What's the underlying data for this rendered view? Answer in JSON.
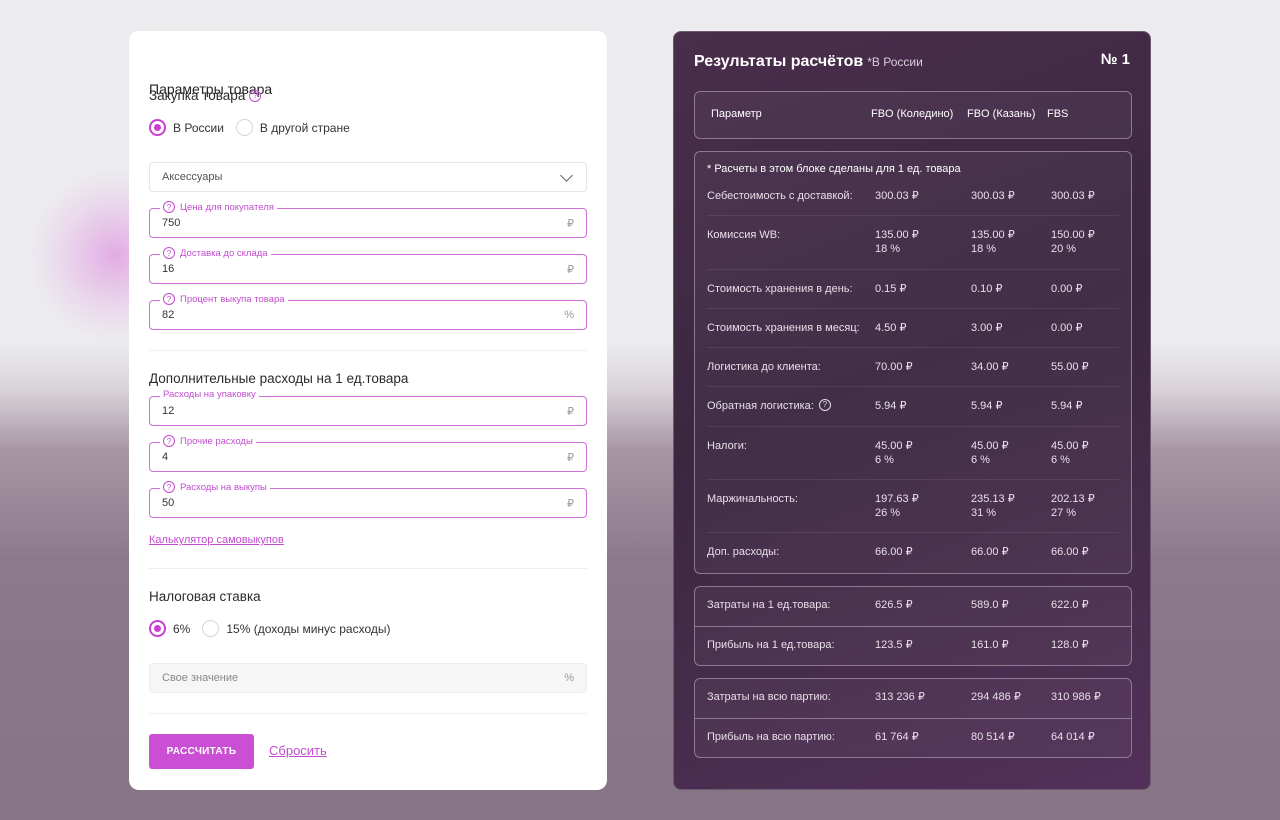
{
  "params": {
    "title": "Параметры товара",
    "purchase_label": "Закупка товара",
    "purchase_options": [
      "В России",
      "В другой стране"
    ],
    "category": "Аксессуары",
    "price_label": "Цена для покупателя",
    "price_value": "750",
    "price_unit": "₽",
    "delivery_label": "Доставка до склада",
    "delivery_value": "16",
    "delivery_unit": "₽",
    "buyout_label": "Процент выкупа товара",
    "buyout_value": "82",
    "buyout_unit": "%",
    "extra_title": "Дополнительные расходы на 1 ед.товара",
    "pack_label": "Расходы на упаковку",
    "pack_value": "12",
    "pack_unit": "₽",
    "other_label": "Прочие расходы",
    "other_value": "4",
    "other_unit": "₽",
    "redemption_label": "Расходы на выкупы",
    "redemption_value": "50",
    "redemption_unit": "₽",
    "calc_link": "Калькулятор самовыкупов",
    "tax_title": "Налоговая ставка",
    "tax_options": [
      "6%",
      "15% (доходы минус расходы)"
    ],
    "custom_placeholder": "Свое значение",
    "custom_unit": "%",
    "calc_button": "РАССЧИТАТЬ",
    "reset_button": "Сбросить"
  },
  "results": {
    "title": "Результаты расчётов",
    "subtitle": "*В России",
    "number": "№ 1",
    "headers": [
      "Параметр",
      "FBO (Коледино)",
      "FBO (Казань)",
      "FBS"
    ],
    "note": "* Расчеты в этом блоке сделаны для 1 ед. товара",
    "unit_rows": [
      {
        "label": "Себестоимость с доставкой:",
        "v": [
          [
            "300.03 ₽"
          ],
          [
            "300.03 ₽"
          ],
          [
            "300.03 ₽"
          ]
        ]
      },
      {
        "label": "Комиссия WB:",
        "v": [
          [
            "135.00 ₽",
            "18 %"
          ],
          [
            "135.00 ₽",
            "18 %"
          ],
          [
            "150.00 ₽",
            "20 %"
          ]
        ]
      },
      {
        "label": "Стоимость хранения в день:",
        "v": [
          [
            "0.15 ₽"
          ],
          [
            "0.10 ₽"
          ],
          [
            "0.00 ₽"
          ]
        ]
      },
      {
        "label": "Стоимость хранения в месяц:",
        "v": [
          [
            "4.50 ₽"
          ],
          [
            "3.00 ₽"
          ],
          [
            "0.00 ₽"
          ]
        ]
      },
      {
        "label": "Логистика до клиента:",
        "v": [
          [
            "70.00 ₽"
          ],
          [
            "34.00 ₽"
          ],
          [
            "55.00 ₽"
          ]
        ]
      },
      {
        "label": "Обратная логистика:",
        "v": [
          [
            "5.94 ₽"
          ],
          [
            "5.94 ₽"
          ],
          [
            "5.94 ₽"
          ]
        ]
      },
      {
        "label": "Налоги:",
        "v": [
          [
            "45.00 ₽",
            "6 %"
          ],
          [
            "45.00 ₽",
            "6 %"
          ],
          [
            "45.00 ₽",
            "6 %"
          ]
        ]
      },
      {
        "label": "Маржинальность:",
        "v": [
          [
            "197.63 ₽",
            "26 %"
          ],
          [
            "235.13 ₽",
            "31 %"
          ],
          [
            "202.13 ₽",
            "27 %"
          ]
        ]
      },
      {
        "label": "Доп. расходы:",
        "v": [
          [
            "66.00 ₽"
          ],
          [
            "66.00 ₽"
          ],
          [
            "66.00 ₽"
          ]
        ]
      }
    ],
    "unit_totals": [
      {
        "label": "Затраты на 1 ед.товара:",
        "v": [
          "626.5 ₽",
          "589.0 ₽",
          "622.0 ₽"
        ]
      },
      {
        "label": "Прибыль на 1 ед.товара:",
        "v": [
          "123.5 ₽",
          "161.0 ₽",
          "128.0 ₽"
        ]
      }
    ],
    "batch_totals": [
      {
        "label": "Затраты на всю партию:",
        "v": [
          "313 236 ₽",
          "294 486 ₽",
          "310 986 ₽"
        ]
      },
      {
        "label": "Прибыль на всю партию:",
        "v": [
          "61 764 ₽",
          "80 514 ₽",
          "64 014 ₽"
        ]
      }
    ]
  }
}
